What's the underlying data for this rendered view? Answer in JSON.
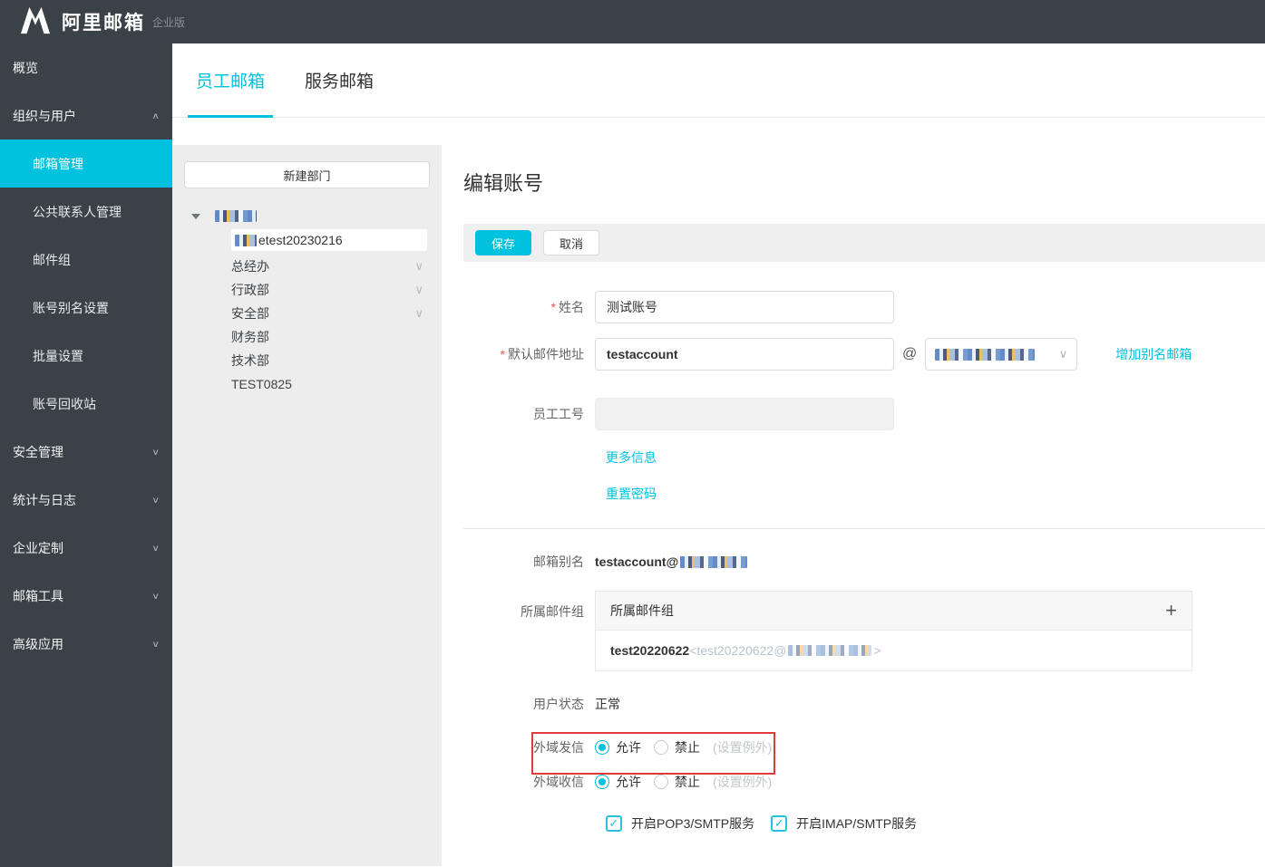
{
  "topbar": {
    "brand": "阿里邮箱",
    "brand_suffix": "企业版"
  },
  "sidebar": {
    "items": [
      {
        "label": "概览"
      },
      {
        "label": "组织与用户",
        "expanded": true,
        "children": [
          {
            "label": "邮箱管理",
            "active": true
          },
          {
            "label": "公共联系人管理"
          },
          {
            "label": "邮件组"
          },
          {
            "label": "账号别名设置"
          },
          {
            "label": "批量设置"
          },
          {
            "label": "账号回收站"
          }
        ]
      },
      {
        "label": "安全管理"
      },
      {
        "label": "统计与日志"
      },
      {
        "label": "企业定制"
      },
      {
        "label": "邮箱工具"
      },
      {
        "label": "高级应用"
      }
    ]
  },
  "tabs": [
    {
      "label": "员工邮箱",
      "active": true
    },
    {
      "label": "服务邮箱",
      "active": false
    }
  ],
  "tree": {
    "new_department_button": "新建部门",
    "selected_item_visible_text": "etest20230216",
    "items": [
      {
        "label": "总经办",
        "has_children": true
      },
      {
        "label": "行政部",
        "has_children": true
      },
      {
        "label": "安全部",
        "has_children": true
      },
      {
        "label": "财务部",
        "has_children": false
      },
      {
        "label": "技术部",
        "has_children": false
      },
      {
        "label": "TEST0825",
        "has_children": false
      }
    ]
  },
  "editor": {
    "title": "编辑账号",
    "save_button": "保存",
    "cancel_button": "取消",
    "name_label": "姓名",
    "name_value": "测试账号",
    "email_label": "默认邮件地址",
    "email_value": "testaccount",
    "at_sign": "@",
    "add_alias_link": "增加别名邮箱",
    "employee_id_label": "员工工号",
    "employee_id_value": "",
    "more_info_link": "更多信息",
    "reset_password_link": "重置密码",
    "alias_label": "邮箱别名",
    "alias_value_prefix": "testaccount@",
    "groups_label": "所属邮件组",
    "groups_header": "所属邮件组",
    "plus_icon": "+",
    "group_name": "test20220622",
    "group_addr_prefix": "<test20220622@",
    "group_addr_suffix": ">",
    "status_label": "用户状态",
    "status_value": "正常",
    "outbound_label": "外域发信",
    "inbound_label": "外域收信",
    "allow_label": "允许",
    "deny_label": "禁止",
    "exception_label": "(设置例外)",
    "outbound_value": "允许",
    "inbound_value": "允许",
    "pop3_checkbox_label": "开启POP3/SMTP服务",
    "imap_checkbox_label": "开启IMAP/SMTP服务",
    "pop3_checked": true,
    "imap_checked": true,
    "check_glyph": "✓"
  },
  "colors": {
    "accent": "#00c1de",
    "sidebar_bg": "#3a4147",
    "highlight": "#e03a3a"
  }
}
